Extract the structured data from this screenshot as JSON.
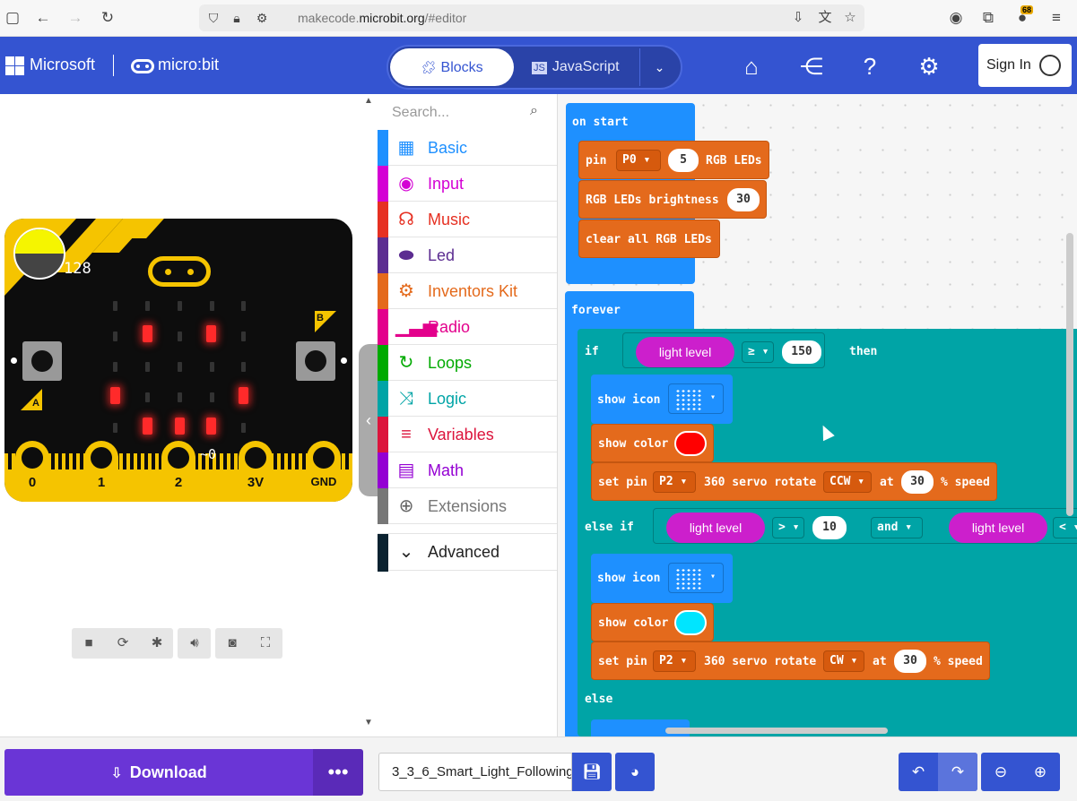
{
  "browser": {
    "url_prefix": "makecode.",
    "url_domain": "microbit.org",
    "url_suffix": "/#editor",
    "badge_count": "68"
  },
  "header": {
    "ms_brand": "Microsoft",
    "mb_brand": "micro:bit",
    "blocks_label": "Blocks",
    "js_label": "JavaScript",
    "signin_label": "Sign In"
  },
  "simulator": {
    "light_value": "128",
    "btn_a": "A",
    "btn_b": "B",
    "pins": [
      "0",
      "1",
      "2",
      "3V",
      "GND"
    ],
    "tilde": "~0"
  },
  "toolbox": {
    "search_placeholder": "Search...",
    "categories": [
      {
        "label": "Basic",
        "color": "#1e90ff",
        "icon": "grid-icon"
      },
      {
        "label": "Input",
        "color": "#d400d4",
        "icon": "target-icon"
      },
      {
        "label": "Music",
        "color": "#e63022",
        "icon": "headphones-icon"
      },
      {
        "label": "Led",
        "color": "#5c2d91",
        "icon": "toggle-icon"
      },
      {
        "label": "Inventors Kit",
        "color": "#e46a1c",
        "icon": "gear-icon"
      },
      {
        "label": "Radio",
        "color": "#e3008c",
        "icon": "signal-icon"
      },
      {
        "label": "Loops",
        "color": "#00aa00",
        "icon": "refresh-icon"
      },
      {
        "label": "Logic",
        "color": "#00a4a6",
        "icon": "shuffle-icon"
      },
      {
        "label": "Variables",
        "color": "#dc143c",
        "icon": "list-icon"
      },
      {
        "label": "Math",
        "color": "#9400d3",
        "icon": "calculator-icon"
      },
      {
        "label": "Extensions",
        "color": "#777777",
        "icon": "plus-icon"
      }
    ],
    "advanced_label": "Advanced"
  },
  "blocks": {
    "on_start": "on start",
    "pin": "pin",
    "p0": "P0",
    "five": "5",
    "rgb_leds": "RGB LEDs",
    "brightness": "RGB LEDs brightness",
    "thirty": "30",
    "clear_all": "clear all RGB LEDs",
    "forever": "forever",
    "if": "if",
    "light_level": "light level",
    "gte": "≥",
    "one_fifty": "150",
    "then": "then",
    "show_icon": "show icon",
    "show_color": "show color",
    "set_pin": "set pin",
    "p2": "P2",
    "servo": "360 servo rotate",
    "ccw": "CCW",
    "cw": "CW",
    "at": "at",
    "speed": "% speed",
    "else_if": "else if",
    "gt": ">",
    "ten": "10",
    "and": "and",
    "lt": "<",
    "else": "else",
    "colors": {
      "red": "#ff0000",
      "cyan": "#00e5ff"
    }
  },
  "footer": {
    "download_label": "Download",
    "more_label": "•••",
    "filename": "3_3_6_Smart_Light_Following"
  }
}
